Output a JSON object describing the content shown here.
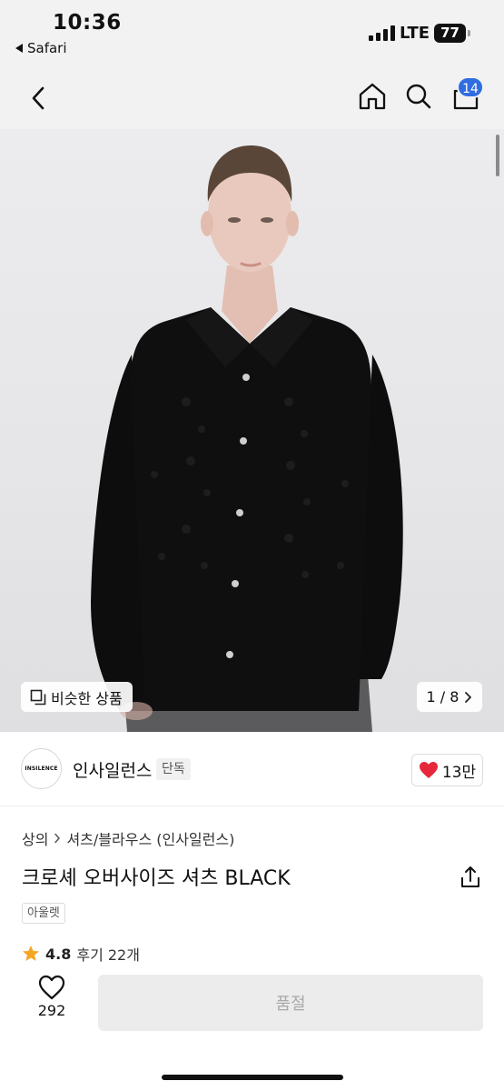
{
  "status_bar": {
    "time": "10:36",
    "back_app": "Safari",
    "network": "LTE",
    "battery": "77"
  },
  "nav": {
    "cart_count": "14"
  },
  "hero": {
    "similar_label": "비슷한 상품",
    "counter": "1 / 8"
  },
  "brand": {
    "logo_text": "INSILENCE",
    "name": "인사일런스",
    "tag": "단독",
    "likes": "13만"
  },
  "product": {
    "breadcrumb": [
      "상의",
      "셔츠/블라우스 (인사일런스)"
    ],
    "title": "크로셰 오버사이즈 셔츠 BLACK",
    "tag": "아울렛",
    "rating": "4.8",
    "reviews": "후기 22개"
  },
  "bottom_bar": {
    "wish_count": "292",
    "soldout_label": "품절"
  },
  "colors": {
    "badge": "#2f6de1",
    "heart": "#e5293b",
    "star": "#f5a623",
    "shirt": "#0f0f10"
  },
  "icons": [
    "back-chevron-icon",
    "home-icon",
    "search-icon",
    "bag-icon",
    "copy-icon",
    "chevron-right-icon",
    "heart-icon",
    "share-icon",
    "star-icon"
  ]
}
